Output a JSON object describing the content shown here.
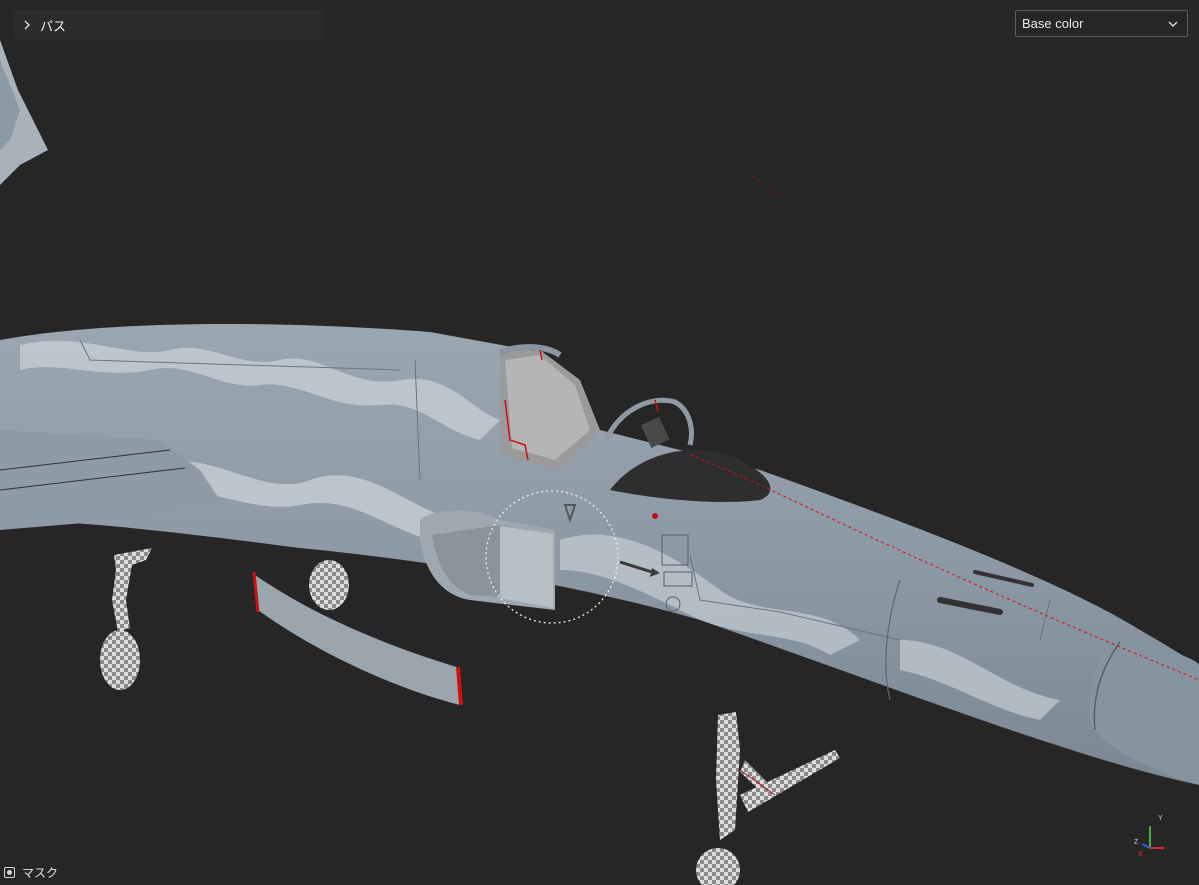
{
  "path_panel": {
    "label": "パス",
    "chevron_icon": "chevron-right-icon"
  },
  "view_mode": {
    "selected": "Base color",
    "caret_icon": "chevron-down-icon"
  },
  "mask": {
    "label": "マスク",
    "icon": "mask-toggle-icon"
  },
  "axis_gizmo": {
    "y": "Y",
    "z": "Z",
    "x": "X",
    "colors": {
      "x": "#d03030",
      "y": "#40b040",
      "z": "#3060d0"
    }
  },
  "colors": {
    "background": "#262626",
    "camo_light": "#a9b4bd",
    "camo_dark": "#8596a6",
    "seam_line": "#d01010"
  }
}
